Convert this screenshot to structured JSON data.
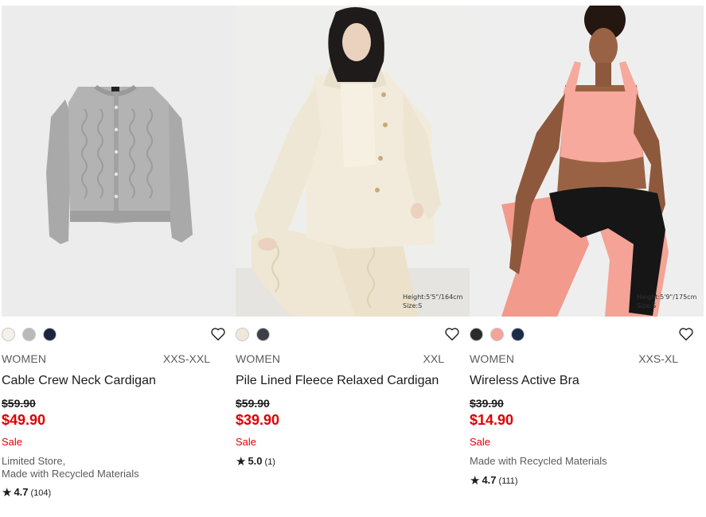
{
  "products": [
    {
      "name": "Cable Crew Neck Cardigan",
      "gender": "WOMEN",
      "sizes": "XXS-XXL",
      "old_price": "$59.90",
      "new_price": "$49.90",
      "sale": "Sale",
      "note_line1": "Limited Store,",
      "note_line2": "Made with Recycled Materials",
      "rating": "4.7",
      "reviews": "(104)",
      "image_caption_1": "",
      "image_caption_2": "",
      "swatch_colors": [
        "#f4f1ea",
        "#b9b9b9",
        "#1b2540"
      ]
    },
    {
      "name": "Pile Lined Fleece Relaxed Cardigan",
      "gender": "WOMEN",
      "sizes": "XXL",
      "old_price": "$59.90",
      "new_price": "$39.90",
      "sale": "Sale",
      "note_line1": "",
      "note_line2": "",
      "rating": "5.0",
      "reviews": "(1)",
      "image_caption_1": "Height:5'5\"/164cm",
      "image_caption_2": "Size:S",
      "swatch_colors": [
        "#efe8d9",
        "#3d3f46"
      ]
    },
    {
      "name": "Wireless Active Bra",
      "gender": "WOMEN",
      "sizes": "XXS-XL",
      "old_price": "$39.90",
      "new_price": "$14.90",
      "sale": "Sale",
      "note_line1": "Made with Recycled Materials",
      "note_line2": "",
      "rating": "4.7",
      "reviews": "(111)",
      "image_caption_1": "Height:5'9\"/175cm",
      "image_caption_2": "Size:S",
      "swatch_colors": [
        "#2a2c2b",
        "#f3a39a",
        "#1c2b4a"
      ]
    }
  ],
  "icons": {
    "wishlist": "heart-outline-icon",
    "star": "star-icon"
  },
  "colors": {
    "sale_red": "#e00000",
    "text": "#1b1b1b",
    "muted": "#5c5c5c"
  }
}
